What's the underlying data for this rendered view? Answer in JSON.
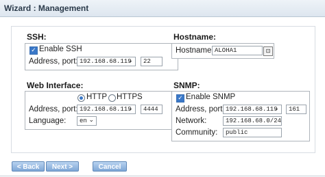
{
  "window": {
    "title": "Wizard : Management"
  },
  "ssh": {
    "heading": "SSH:",
    "enable_label": "Enable SSH",
    "address_label": "Address, port:",
    "address_value": "192.168.68.119",
    "port_value": "22"
  },
  "hostname": {
    "heading": "Hostname:",
    "label": "Hostname:",
    "value": "ALOHA1"
  },
  "web": {
    "heading": "Web Interface:",
    "protocol_http": "HTTP",
    "protocol_https": "HTTPS",
    "selected_protocol": "HTTP",
    "address_label": "Address, port:",
    "address_value": "192.168.68.119",
    "port_value": "4444",
    "language_label": "Language:",
    "language_value": "en"
  },
  "snmp": {
    "heading": "SNMP:",
    "enable_label": "Enable SNMP",
    "address_label": "Address, port:",
    "address_value": "192.168.68.119",
    "port_value": "161",
    "network_label": "Network:",
    "network_value": "192.168.68.0/24",
    "community_label": "Community:",
    "community_value": "public"
  },
  "buttons": {
    "back": "< Back",
    "next": "Next >",
    "cancel": "Cancel"
  },
  "icons": {
    "checkbox": "check-icon",
    "dropdown": "chevron-down-icon",
    "copy": "copy-icon"
  },
  "colors": {
    "accent": "#3a78c8",
    "button": "#7fa7d6"
  }
}
